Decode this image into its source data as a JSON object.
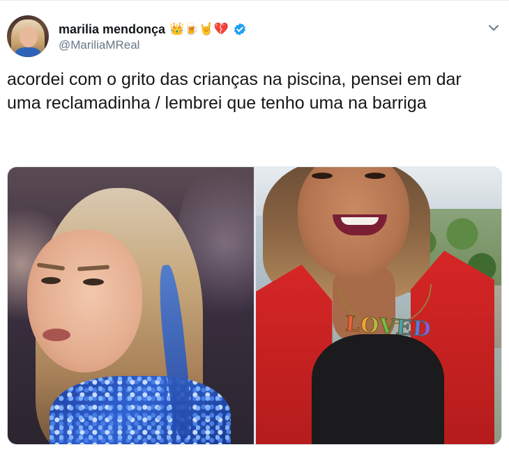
{
  "tweet": {
    "author": {
      "display_name": "marilia mendonça",
      "emojis": "👑🍺🤘💔",
      "handle": "@MariliaMReal",
      "verified": true
    },
    "text": "acordei com o grito das crianças na piscina, pensei em dar uma reclamadinha / lembrei que tenho uma na barriga",
    "media": {
      "count": 2,
      "images": [
        {
          "description_icon": "stage-photo"
        },
        {
          "description_icon": "selfie-photo",
          "necklace_text": "LOVED"
        }
      ]
    },
    "menu_icon": "chevron-down-icon"
  },
  "colors": {
    "text_primary": "#14171a",
    "text_secondary": "#657786",
    "verified_blue": "#1da1f2",
    "border": "#e1e8ed"
  }
}
